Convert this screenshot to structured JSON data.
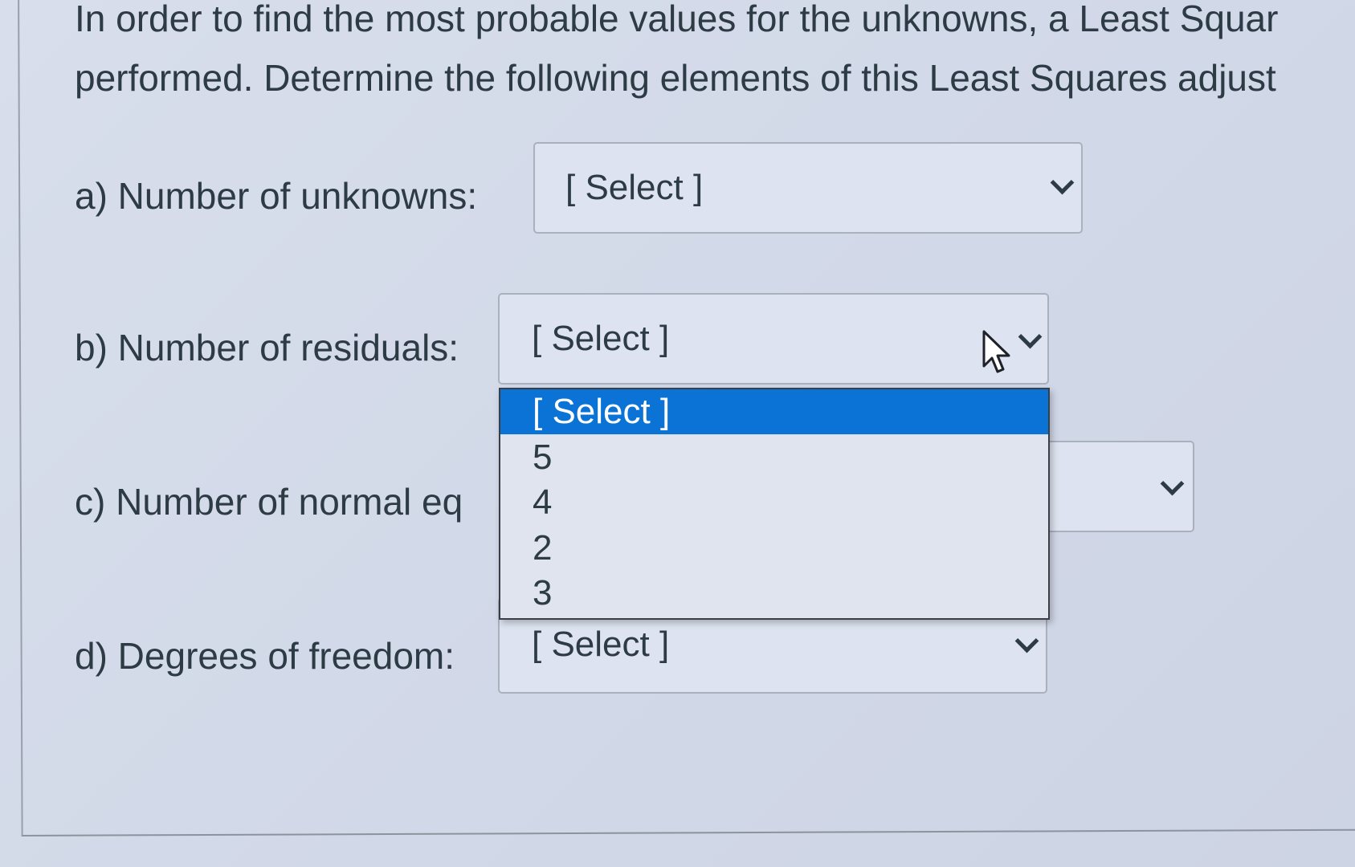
{
  "prompt": {
    "line1": "In order to find the most probable values for the unknowns, a Least Squar",
    "line2": "performed. Determine the following elements of this Least Squares adjust"
  },
  "questions": {
    "a": {
      "label": "a) Number of unknowns:",
      "selected": "[ Select ]"
    },
    "b": {
      "label": "b) Number of residuals:",
      "selected": "[ Select ]"
    },
    "c": {
      "label": "c) Number of normal eq",
      "selected": ""
    },
    "d": {
      "label": "d) Degrees of freedom:",
      "selected": "[ Select ]"
    }
  },
  "dropdown": {
    "options": [
      "[ Select ]",
      "5",
      "4",
      "2",
      "3"
    ],
    "highlighted": "[ Select ]",
    "highlight_color": "#0c73d6"
  },
  "icons": {
    "chevron": "chevron-down-icon",
    "cursor": "mouse-pointer-icon"
  }
}
